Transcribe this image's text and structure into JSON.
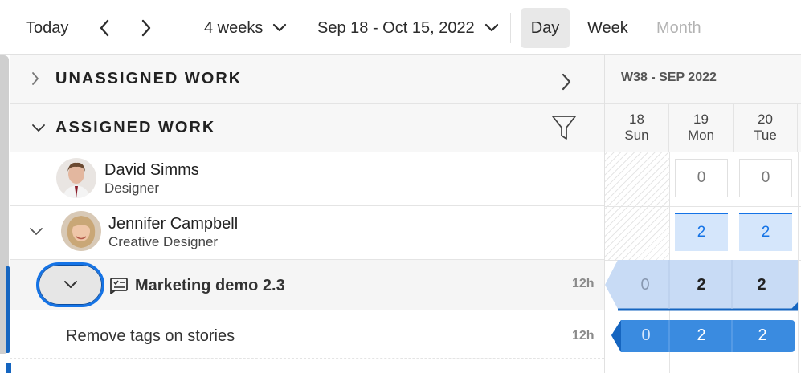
{
  "toolbar": {
    "today": "Today",
    "range": "4 weeks",
    "dates": "Sep 18 - Oct 15, 2022",
    "views": {
      "day": "Day",
      "week": "Week",
      "month": "Month"
    }
  },
  "sections": {
    "unassigned": "UNASSIGNED WORK",
    "assigned": "ASSIGNED WORK"
  },
  "people": [
    {
      "name": "David Simms",
      "role": "Designer"
    },
    {
      "name": "Jennifer Campbell",
      "role": "Creative Designer"
    }
  ],
  "project": {
    "title": "Marketing demo 2.3",
    "hours": "12h"
  },
  "task": {
    "title": "Remove tags on stories",
    "hours": "12h"
  },
  "calendar": {
    "week": "W38 - SEP 2022",
    "days": [
      {
        "num": "18",
        "dow": "Sun"
      },
      {
        "num": "19",
        "dow": "Mon"
      },
      {
        "num": "20",
        "dow": "Tue"
      }
    ],
    "david_capacity": [
      "0",
      "0"
    ],
    "jennifer_capacity": [
      "2",
      "2"
    ],
    "project_values": [
      "0",
      "2",
      "2"
    ],
    "task_values": [
      "0",
      "2",
      "2"
    ]
  },
  "icons": {
    "prev": "chevron-left-icon",
    "next": "chevron-right-icon",
    "filter": "filter-icon",
    "project": "project-icon"
  },
  "colors": {
    "accent": "#1473e6",
    "task_bar": "#3a8be0",
    "project_bar": "#c8dbf5",
    "capacity_fill": "#d5e6fb"
  }
}
